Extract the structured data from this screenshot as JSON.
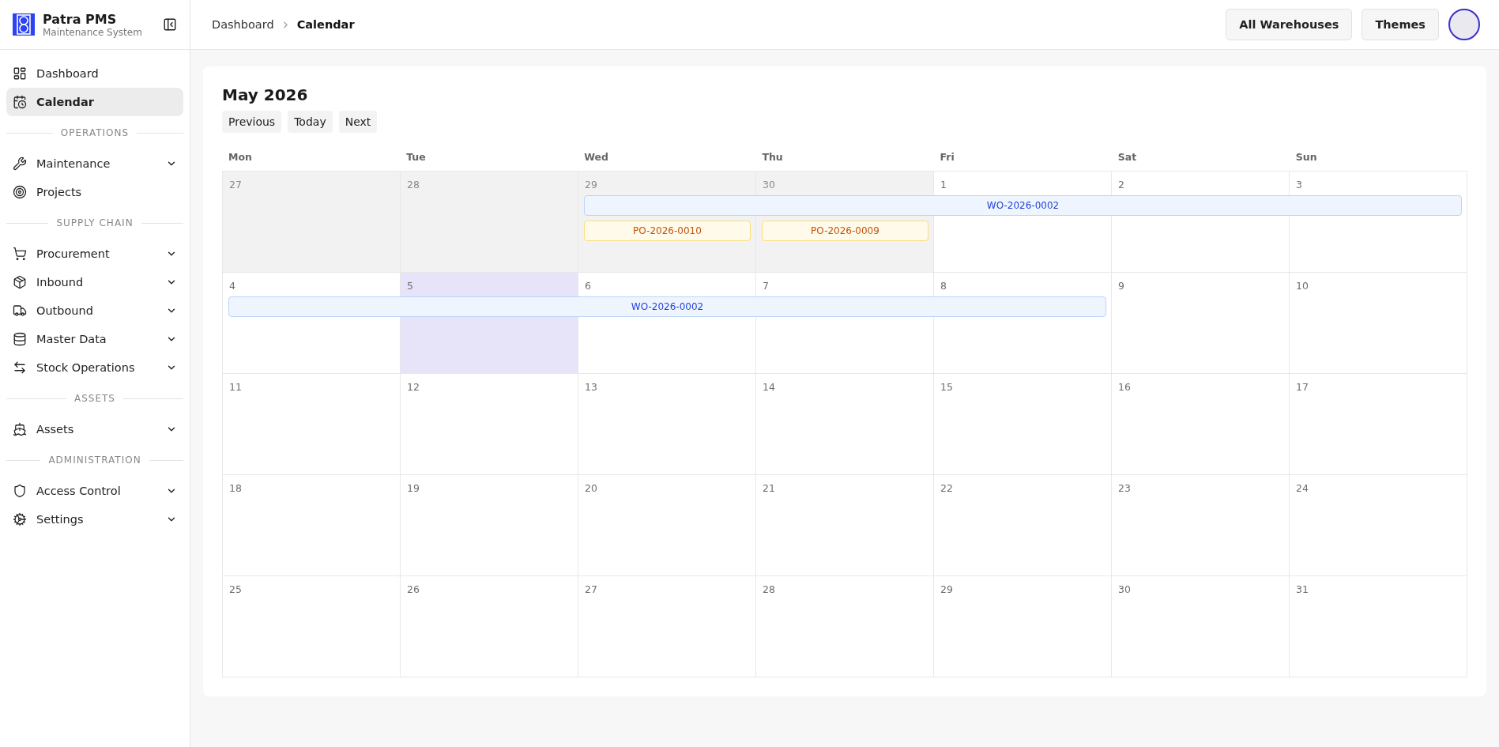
{
  "brand": {
    "name": "Patra PMS",
    "subtitle": "Maintenance System"
  },
  "sidebar": {
    "groups": [
      {
        "items": [
          {
            "label": "Dashboard",
            "selected": false,
            "expandable": false
          },
          {
            "label": "Calendar",
            "selected": true,
            "expandable": false
          }
        ]
      },
      {
        "title": "OPERATIONS",
        "items": [
          {
            "label": "Maintenance",
            "selected": false,
            "expandable": true
          },
          {
            "label": "Projects",
            "selected": false,
            "expandable": false
          }
        ]
      },
      {
        "title": "SUPPLY CHAIN",
        "items": [
          {
            "label": "Procurement",
            "selected": false,
            "expandable": true
          },
          {
            "label": "Inbound",
            "selected": false,
            "expandable": true
          },
          {
            "label": "Outbound",
            "selected": false,
            "expandable": true
          },
          {
            "label": "Master Data",
            "selected": false,
            "expandable": true
          },
          {
            "label": "Stock Operations",
            "selected": false,
            "expandable": true
          }
        ]
      },
      {
        "title": "ASSETS",
        "items": [
          {
            "label": "Assets",
            "selected": false,
            "expandable": true
          }
        ]
      },
      {
        "title": "ADMINISTRATION",
        "items": [
          {
            "label": "Access Control",
            "selected": false,
            "expandable": true
          },
          {
            "label": "Settings",
            "selected": false,
            "expandable": true
          }
        ]
      }
    ]
  },
  "breadcrumbs": [
    {
      "label": "Dashboard",
      "current": false
    },
    {
      "label": "Calendar",
      "current": true
    }
  ],
  "header_buttons": [
    "All Warehouses",
    "Themes"
  ],
  "calendar": {
    "title": "May 2026",
    "nav_buttons": [
      "Previous",
      "Today",
      "Next"
    ],
    "weekdays": [
      "Mon",
      "Tue",
      "Wed",
      "Thu",
      "Fri",
      "Sat",
      "Sun"
    ],
    "weeks": [
      {
        "days": [
          {
            "label": "27",
            "outside": true,
            "selected": false
          },
          {
            "label": "28",
            "outside": true,
            "selected": false
          },
          {
            "label": "29",
            "outside": true,
            "selected": false
          },
          {
            "label": "30",
            "outside": true,
            "selected": false
          },
          {
            "label": "1",
            "outside": false,
            "selected": false
          },
          {
            "label": "2",
            "outside": false,
            "selected": false
          },
          {
            "label": "3",
            "outside": false,
            "selected": false
          }
        ],
        "lanes": [
          [
            {
              "kind": "empty"
            },
            {
              "kind": "empty"
            },
            {
              "kind": "work_order",
              "label": "WO-2026-0002"
            },
            {
              "kind": "continued"
            },
            {
              "kind": "continued"
            },
            {
              "kind": "continued"
            },
            {
              "kind": "continued"
            }
          ],
          [
            {
              "kind": "empty"
            },
            {
              "kind": "empty"
            },
            {
              "kind": "purchase_order",
              "label": "PO-2026-0010"
            },
            {
              "kind": "purchase_order",
              "label": "PO-2026-0009"
            }
          ]
        ]
      },
      {
        "days": [
          {
            "label": "4",
            "outside": false,
            "selected": false
          },
          {
            "label": "5",
            "outside": false,
            "selected": true
          },
          {
            "label": "6",
            "outside": false,
            "selected": false
          },
          {
            "label": "7",
            "outside": false,
            "selected": false
          },
          {
            "label": "8",
            "outside": false,
            "selected": false
          },
          {
            "label": "9",
            "outside": false,
            "selected": false
          },
          {
            "label": "10",
            "outside": false,
            "selected": false
          }
        ],
        "lanes": [
          [
            {
              "kind": "work_order",
              "label": "WO-2026-0002"
            },
            {
              "kind": "continued"
            },
            {
              "kind": "continued"
            },
            {
              "kind": "continued"
            },
            {
              "kind": "continued"
            }
          ]
        ]
      },
      {
        "days": [
          {
            "label": "11",
            "outside": false,
            "selected": false
          },
          {
            "label": "12",
            "outside": false,
            "selected": false
          },
          {
            "label": "13",
            "outside": false,
            "selected": false
          },
          {
            "label": "14",
            "outside": false,
            "selected": false
          },
          {
            "label": "15",
            "outside": false,
            "selected": false
          },
          {
            "label": "16",
            "outside": false,
            "selected": false
          },
          {
            "label": "17",
            "outside": false,
            "selected": false
          }
        ]
      },
      {
        "days": [
          {
            "label": "18",
            "outside": false,
            "selected": false
          },
          {
            "label": "19",
            "outside": false,
            "selected": false
          },
          {
            "label": "20",
            "outside": false,
            "selected": false
          },
          {
            "label": "21",
            "outside": false,
            "selected": false
          },
          {
            "label": "22",
            "outside": false,
            "selected": false
          },
          {
            "label": "23",
            "outside": false,
            "selected": false
          },
          {
            "label": "24",
            "outside": false,
            "selected": false
          }
        ]
      },
      {
        "days": [
          {
            "label": "25",
            "outside": false,
            "selected": false
          },
          {
            "label": "26",
            "outside": false,
            "selected": false
          },
          {
            "label": "27",
            "outside": false,
            "selected": false
          },
          {
            "label": "28",
            "outside": false,
            "selected": false
          },
          {
            "label": "29",
            "outside": false,
            "selected": false
          },
          {
            "label": "30",
            "outside": false,
            "selected": false
          },
          {
            "label": "31",
            "outside": false,
            "selected": false
          }
        ]
      }
    ]
  }
}
